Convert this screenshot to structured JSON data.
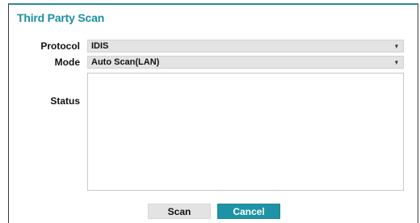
{
  "dialog": {
    "title": "Third Party Scan"
  },
  "form": {
    "protocol_label": "Protocol",
    "protocol_value": "IDIS",
    "mode_label": "Mode",
    "mode_value": "Auto Scan(LAN)",
    "status_label": "Status",
    "status_text": ""
  },
  "buttons": {
    "scan_label": "Scan",
    "cancel_label": "Cancel"
  },
  "icons": {
    "dropdown": "chevron-down-icon"
  },
  "colors": {
    "accent": "#1e93a6",
    "title": "#1a8fa3",
    "field_bg": "#e3e3e3"
  }
}
